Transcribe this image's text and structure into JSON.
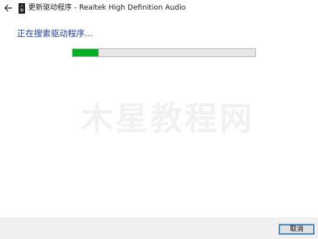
{
  "window": {
    "title": "更新驱动程序 - Realtek High Definition Audio",
    "back_icon": "back-arrow-icon",
    "device_icon": "speaker-device-icon"
  },
  "main": {
    "status_text": "正在搜索驱动程序...",
    "progress_fraction": 0.14,
    "progress_color": "#06b025"
  },
  "watermark": {
    "text": "木星教程网"
  },
  "footer": {
    "cancel_label": "取消"
  },
  "colors": {
    "heading": "#1c3f94",
    "focus_outline": "#0078d7"
  }
}
